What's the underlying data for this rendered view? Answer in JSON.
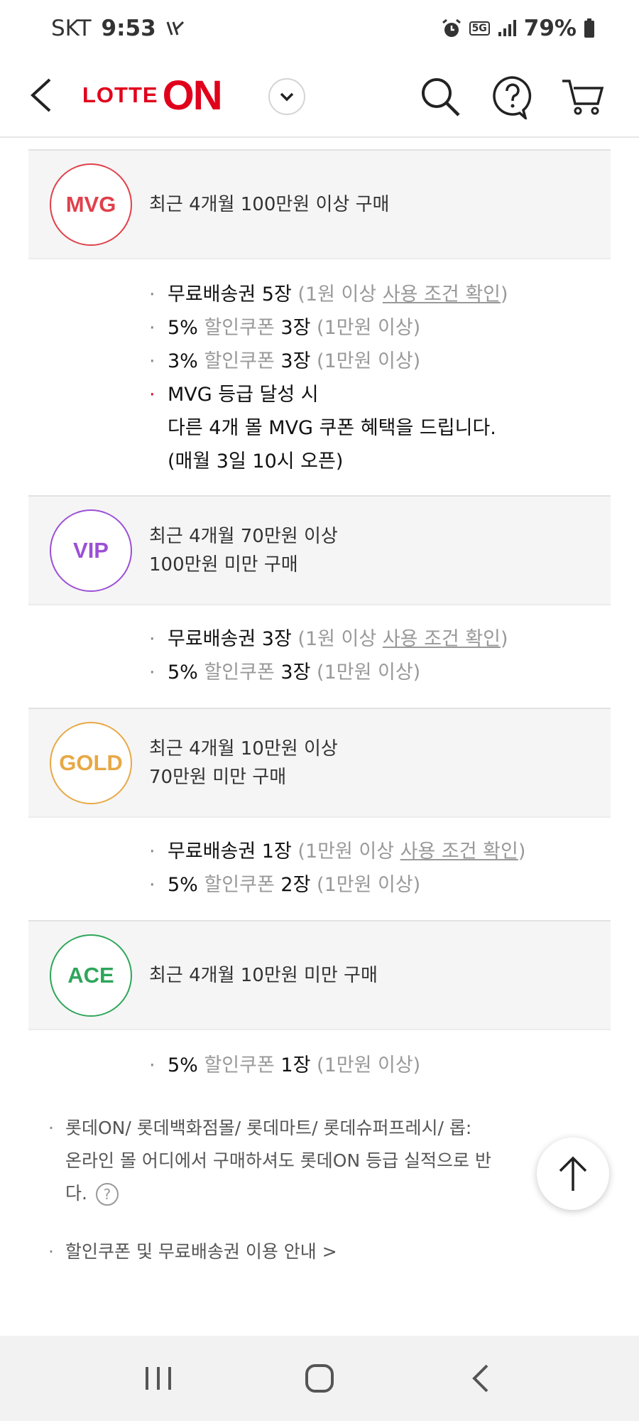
{
  "status": {
    "carrier": "SKT",
    "time": "9:53",
    "network": "5G",
    "battery": "79%"
  },
  "header": {
    "logo_lotte": "LOTTE",
    "logo_on": "ON"
  },
  "grades": [
    {
      "name": "MVG",
      "color": "#e0404a",
      "condition_lines": [
        "최근 4개월 100만원 이상 구매"
      ],
      "benefits": [
        {
          "strong": "무료배송권 5장",
          "note_pre": "(1원 이상 ",
          "link": "사용 조건 확인",
          "note_post": ")"
        },
        {
          "pct": "5%",
          "coupon": "할인쿠폰",
          "qty": "3장",
          "cond": "(1만원 이상)"
        },
        {
          "pct": "3%",
          "coupon": "할인쿠폰",
          "qty": "3장",
          "cond": "(1만원 이상)"
        }
      ],
      "special": [
        "MVG 등급 달성 시",
        "다른 4개 몰 MVG 쿠폰 혜택을 드립니다.",
        "(매월 3일 10시 오픈)"
      ]
    },
    {
      "name": "VIP",
      "color": "#9b4fd6",
      "condition_lines": [
        "최근 4개월 70만원 이상",
        "100만원 미만 구매"
      ],
      "benefits": [
        {
          "strong": "무료배송권 3장",
          "note_pre": "(1원 이상 ",
          "link": "사용 조건 확인",
          "note_post": ")"
        },
        {
          "pct": "5%",
          "coupon": "할인쿠폰",
          "qty": "3장",
          "cond": "(1만원 이상)"
        }
      ]
    },
    {
      "name": "GOLD",
      "color": "#e8a845",
      "condition_lines": [
        "최근 4개월 10만원 이상",
        "70만원 미만 구매"
      ],
      "benefits": [
        {
          "strong": "무료배송권 1장",
          "note_pre": "(1만원 이상 ",
          "link": "사용 조건 확인",
          "note_post": ")"
        },
        {
          "pct": "5%",
          "coupon": "할인쿠폰",
          "qty": "2장",
          "cond": "(1만원 이상)"
        }
      ]
    },
    {
      "name": "ACE",
      "color": "#2ea65a",
      "condition_lines": [
        "최근 4개월 10만원 미만 구매"
      ],
      "benefits": [
        {
          "pct": "5%",
          "coupon": "할인쿠폰",
          "qty": "1장",
          "cond": "(1만원 이상)"
        }
      ]
    }
  ],
  "notes": {
    "mall_note_line1": "롯데ON/ 롯데백화점몰/ 롯데마트/ 롯데슈퍼프레시/ 롭:",
    "mall_note_line2": "온라인 몰 어디에서 구매하셔도 롯데ON 등급 실적으로 반",
    "mall_note_line3": "다.",
    "help_glyph": "?",
    "coupon_guide": "할인쿠폰 및 무료배송권 이용 안내 >"
  }
}
